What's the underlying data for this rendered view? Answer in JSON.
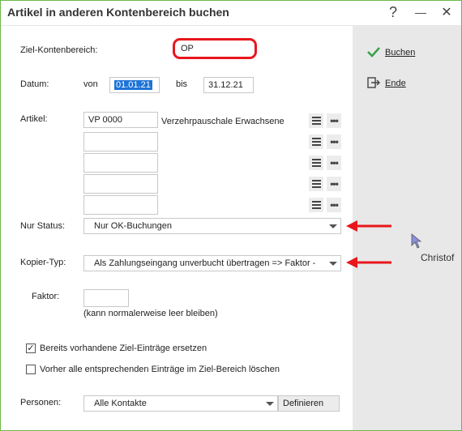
{
  "window": {
    "title": "Artikel in anderen Kontenbereich buchen",
    "help_glyph": "?",
    "minimize_glyph": "—",
    "close_glyph": "✕"
  },
  "side_buttons": {
    "book_label": "Buchen",
    "end_label": "Ende"
  },
  "form": {
    "target_area_label": "Ziel-Kontenbereich:",
    "target_area_value": "OP",
    "date_label": "Datum:",
    "date_from_label": "von",
    "date_from_value": "01.01.21",
    "date_to_label": "bis",
    "date_to_value": "31.12.21",
    "article_label": "Artikel:",
    "article_rows": [
      {
        "code": "VP     0000",
        "description": "Verzehrpauschale Erwachsene"
      },
      {
        "code": "",
        "description": ""
      },
      {
        "code": "",
        "description": ""
      },
      {
        "code": "",
        "description": ""
      },
      {
        "code": "",
        "description": ""
      }
    ],
    "status_label": "Nur Status:",
    "status_value": "Nur OK-Buchungen",
    "copy_type_label": "Kopier-Typ:",
    "copy_type_value": "Als Zahlungseingang unverbucht übertragen => Faktor -",
    "factor_label": "Faktor:",
    "factor_value": "",
    "factor_hint": "(kann normalerweise leer bleiben)",
    "replace_checkbox_label": "Bereits vorhandene Ziel-Einträge ersetzen",
    "replace_checked": true,
    "delete_checkbox_label": "Vorher alle entsprechenden Einträge im Ziel-Bereich löschen",
    "delete_checked": false,
    "persons_label": "Personen:",
    "persons_value": "Alle Kontakte",
    "define_button_label": "Definieren"
  },
  "tooltip": {
    "text": "Christof"
  },
  "colors": {
    "accent_border": "#6bb84a",
    "highlight_red": "#e8171c",
    "selection_blue": "#1e73d6",
    "side_panel": "#e8e8e8",
    "check_green": "#3aa14a"
  }
}
